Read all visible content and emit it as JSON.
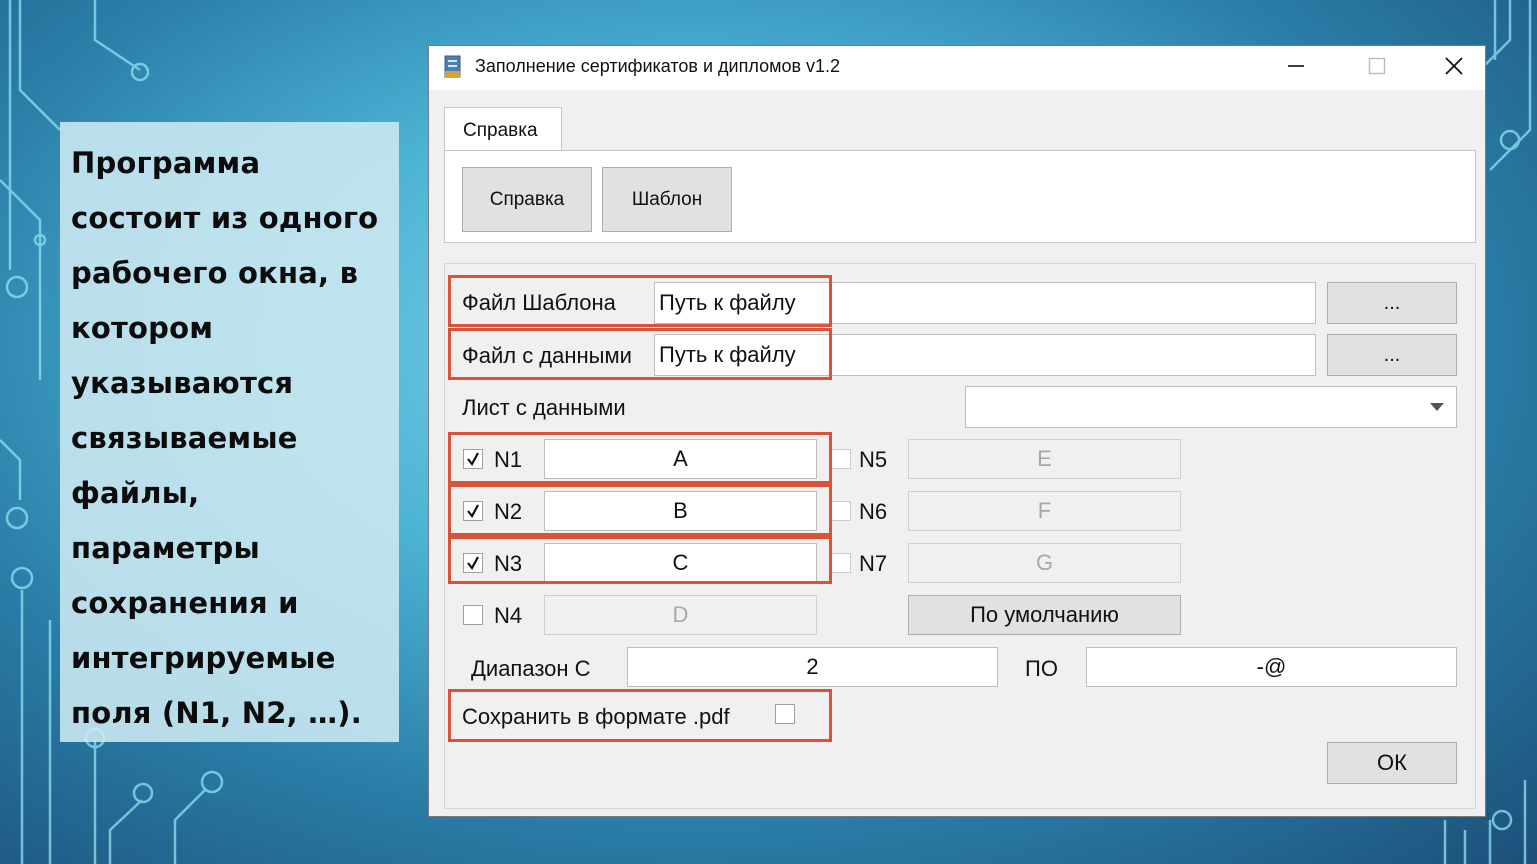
{
  "slide": {
    "text": "Программа состоит из одного рабочего окна, в котором указываются связываемые файлы, параметры сохранения и интегрируемые поля (N1, N2, …)."
  },
  "window": {
    "title": "Заполнение сертификатов и дипломов v1.2",
    "controls": {
      "minimize": "—",
      "maximize": "☐",
      "close": "✕"
    }
  },
  "tabs": [
    {
      "label": "Справка",
      "active": true
    }
  ],
  "tab_content": {
    "help_button": "Справка",
    "template_button": "Шаблон"
  },
  "form": {
    "template_file": {
      "label": "Файл Шаблона",
      "value": "Путь к файлу",
      "browse": "..."
    },
    "data_file": {
      "label": "Файл с данными",
      "value": "Путь к файлу",
      "browse": "..."
    },
    "sheet": {
      "label": "Лист с данными",
      "selected": ""
    },
    "fields": [
      {
        "name": "N1",
        "value": "A",
        "checked": true
      },
      {
        "name": "N2",
        "value": "B",
        "checked": true
      },
      {
        "name": "N3",
        "value": "C",
        "checked": true
      },
      {
        "name": "N4",
        "value": "D",
        "checked": false
      },
      {
        "name": "N5",
        "value": "E",
        "checked": false
      },
      {
        "name": "N6",
        "value": "F",
        "checked": false
      },
      {
        "name": "N7",
        "value": "G",
        "checked": false
      }
    ],
    "default_button": "По умолчанию",
    "range": {
      "from_label": "Диапазон С",
      "from_value": "2",
      "to_label": "ПО",
      "to_value": "-@"
    },
    "save_pdf": {
      "label": "Сохранить в формате .pdf",
      "checked": false
    },
    "ok_button": "ОК"
  },
  "colors": {
    "highlight": "#d9533b",
    "window_bg": "#f0f0f0"
  },
  "icons": {
    "app": "document-icon",
    "check": "checkmark-icon",
    "dropdown": "chevron-down-icon"
  }
}
